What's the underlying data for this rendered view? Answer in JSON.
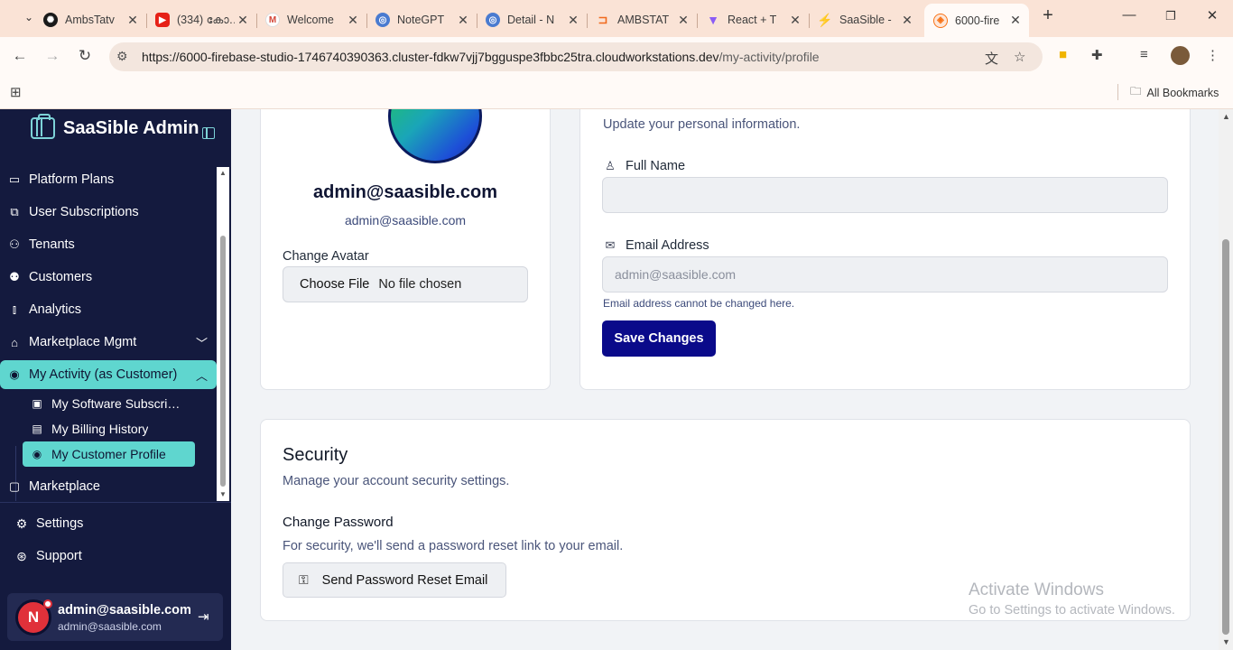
{
  "browser": {
    "tabs": [
      {
        "title": "AmbsTatv",
        "icon": "openai-icon",
        "color": "#1a1a1a"
      },
      {
        "title": "(334) കോ…",
        "icon": "youtube-icon",
        "color": "#e62117"
      },
      {
        "title": "Welcome",
        "icon": "gmail-icon",
        "color": "#d44638"
      },
      {
        "title": "NoteGPT",
        "icon": "globe-icon",
        "color": "#4a7bd0"
      },
      {
        "title": "Detail - N",
        "icon": "globe-icon",
        "color": "#4a7bd0"
      },
      {
        "title": "AMBSTAT",
        "icon": "ambstat-icon",
        "color": "#f06a1d"
      },
      {
        "title": "React + T",
        "icon": "vite-icon",
        "color": "#8b5cf6"
      },
      {
        "title": "SaaSible -",
        "icon": "firebase-icon",
        "color": "#f59e0b"
      },
      {
        "title": "6000-fire",
        "icon": "firebase-studio-icon",
        "color": "#f97316"
      }
    ],
    "url_host": "https://6000-firebase-studio-1746740390363.cluster-fdkw7vjj7bgguspe3fbbc25tra.cloudworkstations.dev",
    "url_path": "/my-activity/profile",
    "bookmarks_label": "All Bookmarks"
  },
  "sidebar": {
    "brand": "SaaSible Admin",
    "items": [
      {
        "label": "Platform Plans",
        "icon": "id-card-icon"
      },
      {
        "label": "User Subscriptions",
        "icon": "subscription-icon"
      },
      {
        "label": "Tenants",
        "icon": "users-icon"
      },
      {
        "label": "Customers",
        "icon": "user-check-icon"
      },
      {
        "label": "Analytics",
        "icon": "bar-chart-icon"
      },
      {
        "label": "Marketplace Mgmt",
        "icon": "store-icon"
      },
      {
        "label": "My Activity (as Customer)",
        "icon": "user-circle-icon"
      },
      {
        "label": "Marketplace",
        "icon": "shopping-bag-icon"
      }
    ],
    "sub_items": [
      {
        "label": "My Software Subscriptions",
        "icon": "package-icon"
      },
      {
        "label": "My Billing History",
        "icon": "receipt-icon"
      },
      {
        "label": "My Customer Profile",
        "icon": "user-circle-icon"
      }
    ],
    "footer": [
      {
        "label": "Settings",
        "icon": "gear-icon"
      },
      {
        "label": "Support",
        "icon": "lifebuoy-icon"
      }
    ],
    "user": {
      "initial": "N",
      "name": "admin@saasible.com",
      "email": "admin@saasible.com"
    }
  },
  "profile_card": {
    "display_name": "admin@saasible.com",
    "email": "admin@saasible.com",
    "change_avatar_label": "Change Avatar",
    "choose_file_label": "Choose File",
    "no_file_label": "No file chosen"
  },
  "personal_info": {
    "subtitle": "Update your personal information.",
    "full_name_label": "Full Name",
    "full_name_value": "",
    "email_label": "Email Address",
    "email_placeholder": "admin@saasible.com",
    "email_hint": "Email address cannot be changed here.",
    "save_label": "Save Changes"
  },
  "security": {
    "title": "Security",
    "subtitle": "Manage your account security settings.",
    "change_password_label": "Change Password",
    "change_password_desc": "For security, we'll send a password reset link to your email.",
    "reset_button_label": "Send Password Reset Email"
  },
  "watermark": {
    "line1": "Activate Windows",
    "line2": "Go to Settings to activate Windows."
  }
}
